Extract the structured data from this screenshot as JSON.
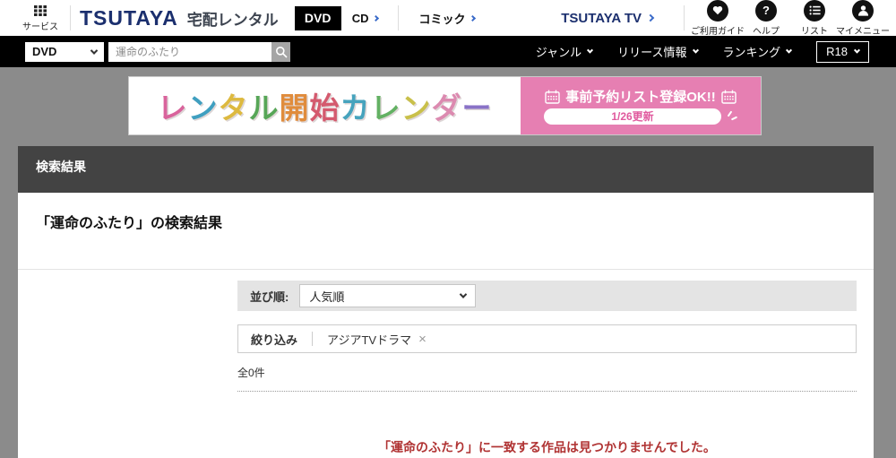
{
  "header": {
    "service_label": "サービス",
    "logo": "TSUTAYA",
    "logo_suffix": "宅配レンタル",
    "tabs": [
      {
        "label": "DVD"
      },
      {
        "label": "CD"
      },
      {
        "label": "コミック"
      }
    ],
    "tsutaya_tv_label": "TSUTAYA TV",
    "utility": [
      {
        "label": "ご利用ガイド"
      },
      {
        "label": "ヘルプ",
        "glyph": "?"
      },
      {
        "label": "リスト"
      },
      {
        "label": "マイメニュー"
      }
    ]
  },
  "searchbar": {
    "category_value": "DVD",
    "query_value": "運命のふたり",
    "links": [
      {
        "label": "ジャンル"
      },
      {
        "label": "リリース情報"
      },
      {
        "label": "ランキング"
      }
    ],
    "r18_label": "R18"
  },
  "banner": {
    "title_chars": [
      {
        "ch": "レ",
        "color": "#d9639c"
      },
      {
        "ch": "ン",
        "color": "#3f9fc0"
      },
      {
        "ch": "タ",
        "color": "#ddb93f"
      },
      {
        "ch": "ル",
        "color": "#57a657"
      },
      {
        "ch": "開",
        "color": "#e08c3c"
      },
      {
        "ch": "始",
        "color": "#d45a6e"
      },
      {
        "ch": "カ",
        "color": "#46a3bd"
      },
      {
        "ch": "レ",
        "color": "#63b163"
      },
      {
        "ch": "ン",
        "color": "#c9c04a"
      },
      {
        "ch": "ダ",
        "color": "#dc8ab0"
      },
      {
        "ch": "ー",
        "color": "#8972c7"
      }
    ],
    "promo_line": "事前予約リスト登録OK!!",
    "update_pill": "1/26更新"
  },
  "results": {
    "section_title": "検索結果",
    "page_title": "「運命のふたり」の検索結果",
    "sort_label": "並び順:",
    "sort_value": "人気順",
    "filter_label": "絞り込み",
    "filter_tag": "アジアTVドラマ",
    "tag_close": "×",
    "count": "全0件",
    "empty_message": "「運命のふたり」に一致する作品は見つかりませんでした。"
  },
  "colors": {
    "brand_navy": "#1b2f6e",
    "banner_pink": "#e67fb2",
    "page_gray": "#8b8b8b",
    "section_bar": "#434343",
    "error_red": "#b03333"
  }
}
